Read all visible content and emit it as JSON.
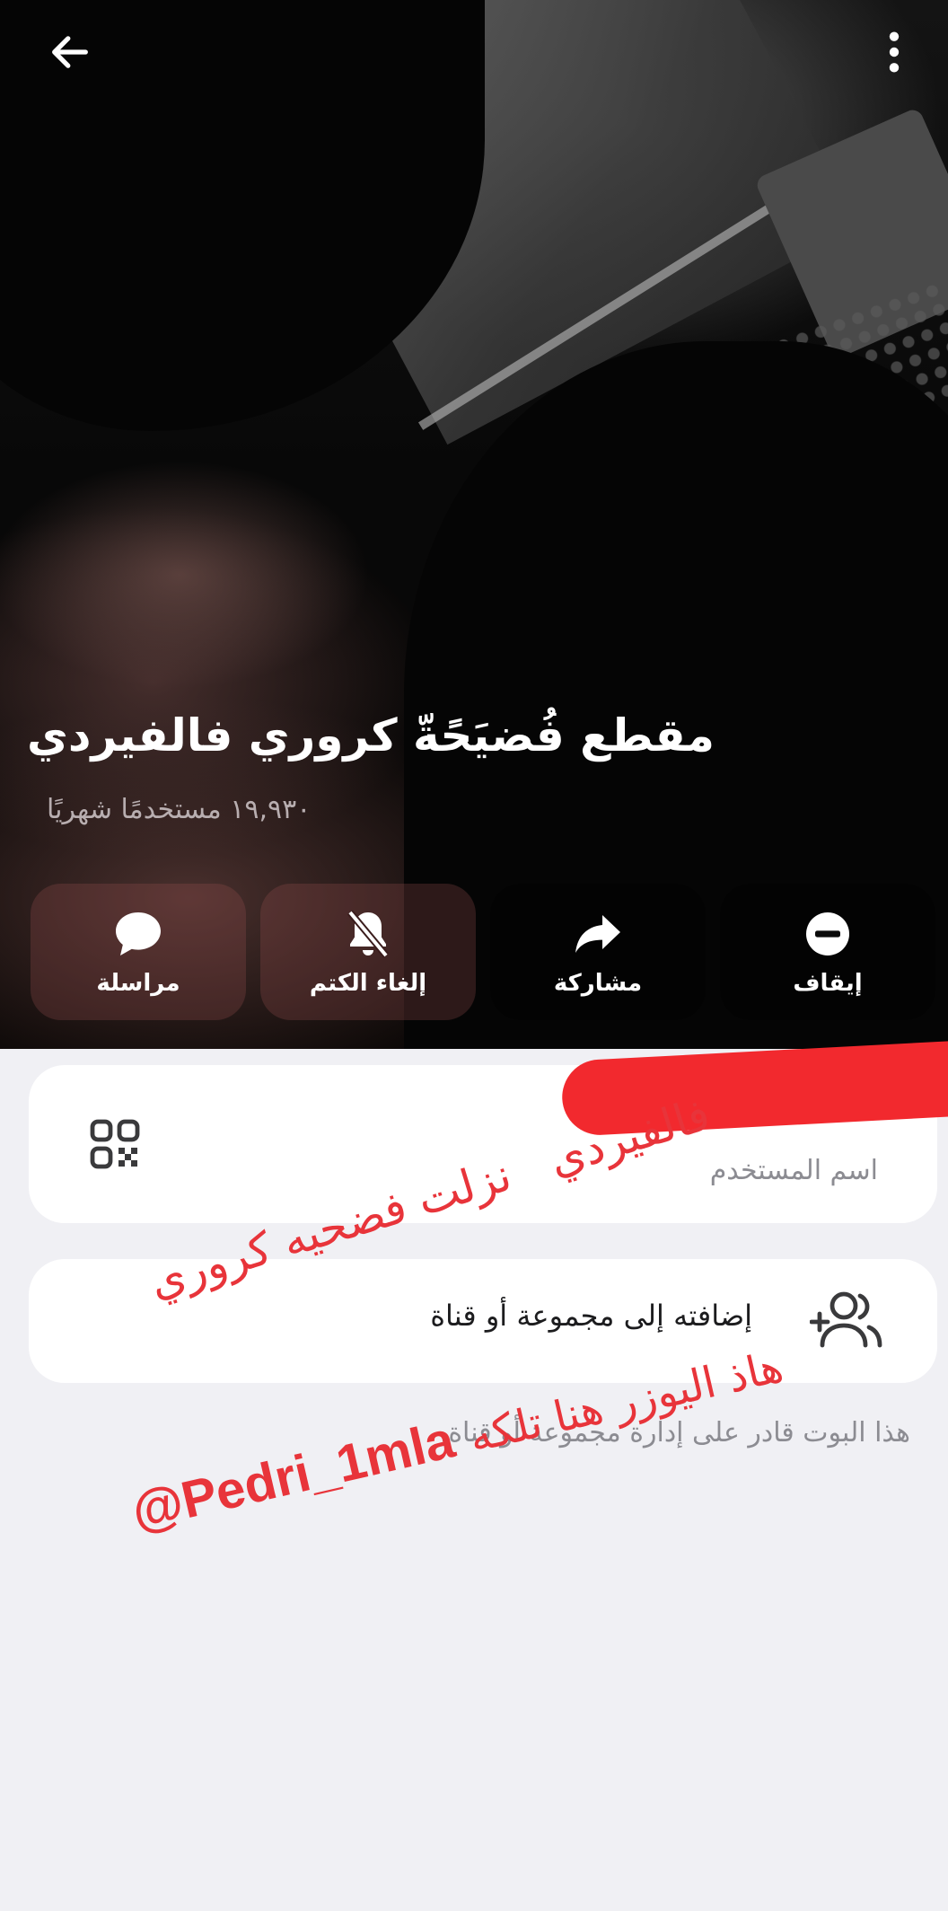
{
  "header": {
    "title": "مقطع فُضيَحًةّ كروري فالفيردي",
    "subtitle": "١٩,٩٣٠ مستخدمًا شهريًا",
    "back_icon": "arrow-left-icon",
    "more_icon": "more-vertical-icon"
  },
  "actions": [
    {
      "label": "مراسلة",
      "icon": "chat-bubble-icon"
    },
    {
      "label": "إلغاء الكتم",
      "icon": "bell-off-icon"
    },
    {
      "label": "مشاركة",
      "icon": "share-arrow-icon"
    },
    {
      "label": "إيقاف",
      "icon": "stop-minus-icon"
    }
  ],
  "username_card": {
    "label": "اسم المستخدم",
    "qr_icon": "qr-code-icon"
  },
  "add_card": {
    "label": "إضافته إلى مجموعة أو قناة",
    "icon": "add-users-icon"
  },
  "footnote": "هذا البوت قادر على إدارة مجموعة أو قناة.",
  "overlay": {
    "line1a": "نزلت فضحيه كروري",
    "line1b": "فالفيردي",
    "line2_handle": "@Pedri_1mla",
    "line2_text": "هاذ اليوزر هنا تلكه"
  },
  "colors": {
    "accent_red": "#e8343a",
    "redaction": "#f2292e",
    "background": "#f0f0f4",
    "card": "#ffffff"
  }
}
